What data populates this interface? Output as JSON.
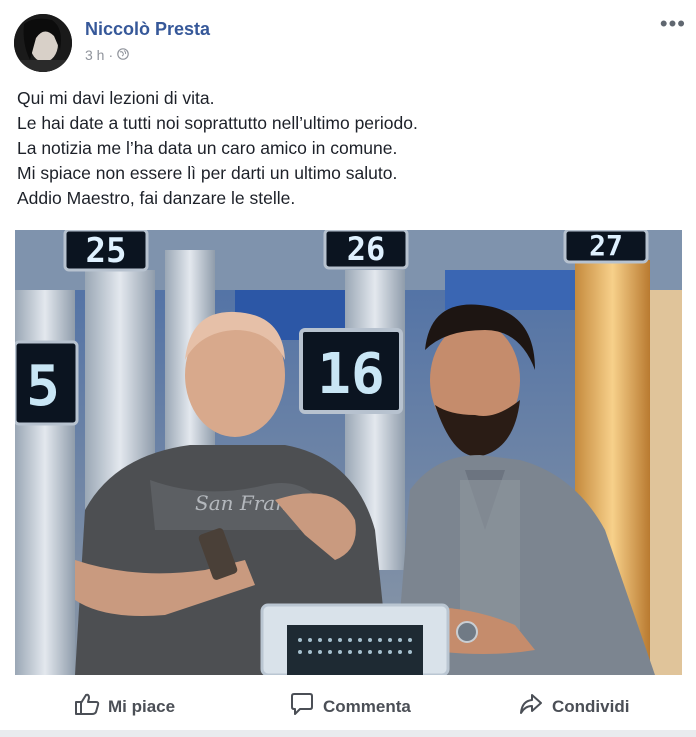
{
  "post": {
    "author": "Niccolò Presta",
    "time": "3 h",
    "separator": "·",
    "more_label": "•••",
    "lines": [
      "Qui mi davi lezioni di vita.",
      "Le hai date a tutti noi soprattutto nell’ultimo periodo.",
      "La notizia me l’ha data un caro amico in comune.",
      "Mi spiace non essere lì per darti un ultimo saluto.",
      "Addio Maestro, fai danzare le stelle."
    ]
  },
  "photo": {
    "scoreboards": [
      "25",
      "26",
      "27",
      "5",
      "16"
    ]
  },
  "actions": {
    "like": "Mi piace",
    "comment": "Commenta",
    "share": "Condividi"
  },
  "colors": {
    "author": "#365899",
    "action_text": "#4b4f56",
    "meta": "#90949c"
  }
}
